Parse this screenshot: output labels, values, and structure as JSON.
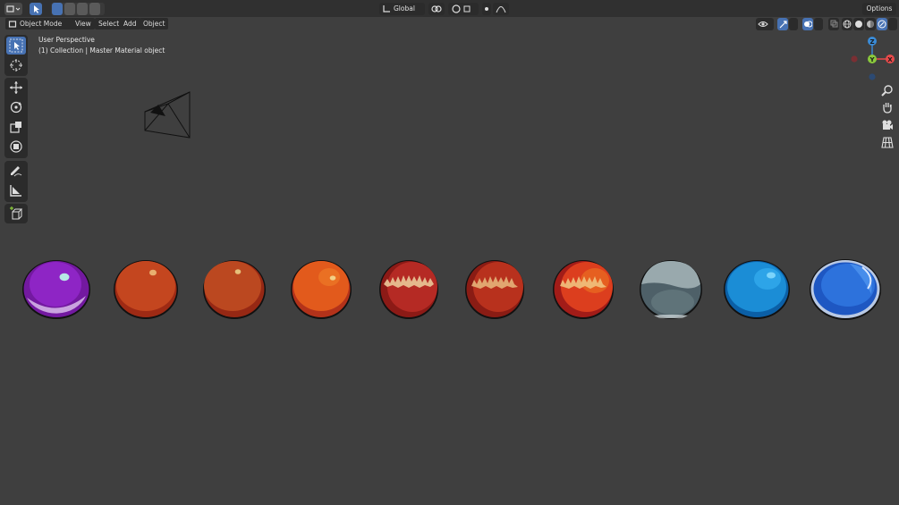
{
  "header": {
    "mode_label": "Object Mode",
    "menus": [
      "View",
      "Select",
      "Add",
      "Object"
    ],
    "orientation_label": "Global",
    "options_label": "Options"
  },
  "viewport": {
    "view_name": "User Perspective",
    "collection_info": "(1) Collection | Master Material object"
  },
  "gizmo": {
    "z_label": "Z",
    "y_label": "Y",
    "x_label": "X"
  },
  "toolbar": {
    "tools": [
      "select-box",
      "cursor",
      "move",
      "rotate",
      "scale",
      "transform",
      "annotate",
      "measure",
      "add-cube"
    ]
  },
  "colors": {
    "accent": "#4772b3",
    "viewport_bg": "#3f3f3f",
    "gizmo_x": "#e84a4a",
    "gizmo_y": "#8ac93c",
    "gizmo_z": "#3a8cd8"
  },
  "materials": [
    {
      "name": "purple",
      "color": "#8a1fb8"
    },
    {
      "name": "orange-red-1",
      "color": "#c0441c"
    },
    {
      "name": "orange-red-2",
      "color": "#b8441e"
    },
    {
      "name": "orange",
      "color": "#e05a18"
    },
    {
      "name": "red-fur-1",
      "color": "#b82b22"
    },
    {
      "name": "red-fur-2",
      "color": "#b8301e"
    },
    {
      "name": "red-fur-3",
      "color": "#d43a1e"
    },
    {
      "name": "grey-glass",
      "color": "#8fa0a6"
    },
    {
      "name": "blue-1",
      "color": "#1a8fd8"
    },
    {
      "name": "blue-2",
      "color": "#2a6ed0"
    }
  ]
}
